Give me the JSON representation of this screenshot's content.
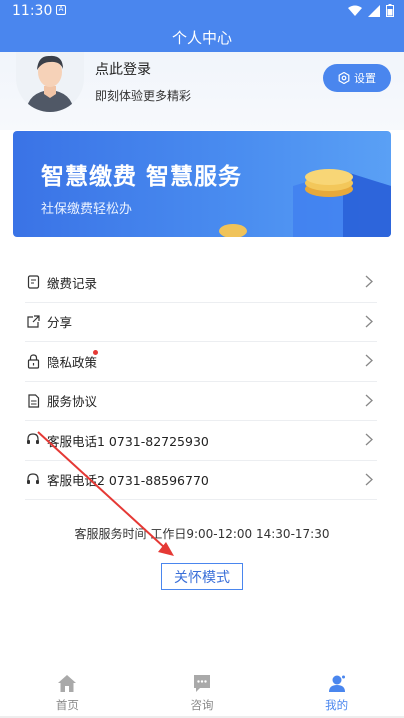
{
  "status_bar": {
    "time": "11:30",
    "notification_glyph": "A"
  },
  "header": {
    "title": "个人中心"
  },
  "profile": {
    "login_text": "点此登录",
    "login_sub": "即刻体验更多精彩",
    "settings_label": "设置"
  },
  "banner": {
    "title": "智慧缴费  智慧服务",
    "subtitle": "社保缴费轻松办"
  },
  "menu": {
    "items": [
      {
        "label": "缴费记录",
        "icon": "receipt-icon"
      },
      {
        "label": "分享",
        "icon": "share-icon"
      },
      {
        "label": "隐私政策",
        "icon": "privacy-lock-icon"
      },
      {
        "label": "服务协议",
        "icon": "document-icon"
      },
      {
        "label": "客服电话1 0731-82725930",
        "icon": "headset-icon"
      },
      {
        "label": "客服电话2 0731-88596770",
        "icon": "headset-icon"
      }
    ]
  },
  "service_time": "客服服务时间 工作日9:00-12:00 14:30-17:30",
  "care_mode_label": "关怀模式",
  "bottom_nav": {
    "items": [
      {
        "label": "首页",
        "icon": "home-icon",
        "active": false
      },
      {
        "label": "咨询",
        "icon": "chat-icon",
        "active": false
      },
      {
        "label": "我的",
        "icon": "profile-icon",
        "active": true
      }
    ]
  },
  "colors": {
    "accent": "#4a86ee",
    "annotation": "#e53935",
    "dot": "#e53935"
  }
}
